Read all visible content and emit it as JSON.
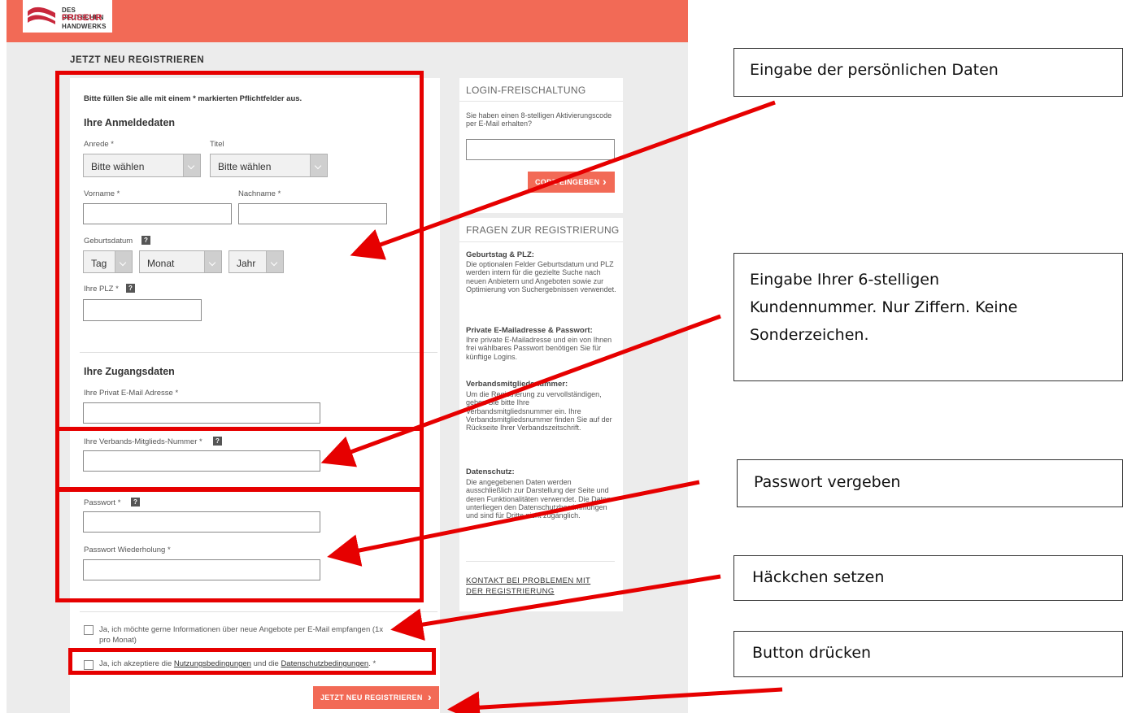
{
  "brand": {
    "logo_line1": "DES DEUTSCHEN",
    "logo_line2": "FRISEUR",
    "logo_line3": "HANDWERKS",
    "accent_color": "#f26a56",
    "annotation_color": "#e60000"
  },
  "page_title": "JETZT NEU REGISTRIEREN",
  "form": {
    "required_note": "Bitte füllen Sie alle mit einem * markierten Pflichtfelder aus.",
    "section_login": "Ihre Anmeldedaten",
    "anrede_label": "Anrede *",
    "titel_label": "Titel",
    "anrede_value": "Bitte wählen",
    "titel_value": "Bitte wählen",
    "vorname_label": "Vorname *",
    "nachname_label": "Nachname *",
    "geburtsdatum_label": "Geburtsdatum",
    "tag_value": "Tag",
    "monat_value": "Monat",
    "jahr_value": "Jahr",
    "plz_label": "Ihre PLZ *",
    "section_access": "Ihre Zugangsdaten",
    "email_label": "Ihre Privat E-Mail Adresse *",
    "member_label": "Ihre Verbands-Mitglieds-Nummer *",
    "password_label": "Passwort *",
    "password_repeat_label": "Passwort Wiederholung *",
    "newsletter_label": "Ja, ich möchte gerne Informationen über neue Angebote per E-Mail empfangen (1x pro Monat)",
    "terms_prefix": "Ja, ich akzeptiere die ",
    "terms_link1": "Nutzungsbedingungen",
    "terms_mid": " und die ",
    "terms_link2": "Datenschutzbedingungen",
    "terms_suffix": ". *",
    "submit_label": "JETZT NEU REGISTRIEREN",
    "help_glyph": "?",
    "chevron": "›"
  },
  "sidebar": {
    "login_title": "LOGIN-FREISCHALTUNG",
    "login_text": "Sie haben einen 8-stelligen Aktivierungscode per E-Mail erhalten?",
    "code_button": "CODE EINGEBEN",
    "faq_title": "FRAGEN ZUR REGISTRIERUNG",
    "faq": [
      {
        "head": "Geburtstag & PLZ:",
        "body": "Die optionalen Felder Geburtsdatum und PLZ werden intern für die gezielte Suche nach neuen Anbietern und Angeboten sowie zur Optimierung von Suchergebnissen verwendet."
      },
      {
        "head": "Private E-Mailadresse & Passwort:",
        "body": "Ihre private E-Mailadresse und ein von Ihnen frei wählbares Passwort benötigen Sie für künftige Logins."
      },
      {
        "head": "Verbandsmitgliedsnummer:",
        "body": "Um die Registrierung zu vervollständigen, geben Sie bitte Ihre Verbandsmitgliedsnummer ein. Ihre Verbandsmitgliedsnummer finden Sie auf der Rückseite Ihrer Verbandszeitschrift."
      },
      {
        "head": "Datenschutz:",
        "body": "Die angegebenen Daten werden ausschließlich zur Darstellung der Seite und deren Funktionalitäten verwendet. Die Daten unterliegen den Datenschutzbestimmungen und sind für Dritte nicht zugänglich."
      }
    ],
    "contact_link": "KONTAKT BEI PROBLEMEN MIT DER REGISTRIERUNG"
  },
  "callouts": {
    "c1": "Eingabe der persönlichen Daten",
    "c2_l1": "Eingabe Ihrer 6-stelligen",
    "c2_l2": "Kundennummer. Nur Ziffern. Keine",
    "c2_l3": "Sonderzeichen.",
    "c3": "Passwort vergeben",
    "c4": "Häckchen setzen",
    "c5": "Button drücken"
  }
}
